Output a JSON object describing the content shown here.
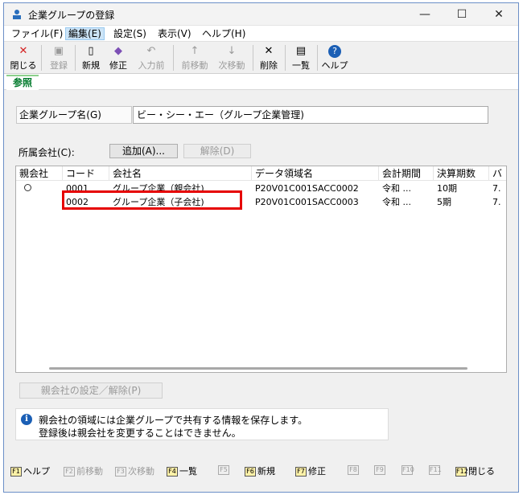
{
  "window": {
    "title": "企業グループの登録"
  },
  "titlebar_buttons": {
    "minimize": "—",
    "maximize": "☐",
    "close": "✕"
  },
  "menu": [
    {
      "label": "ファイル(F)"
    },
    {
      "label": "編集(E)"
    },
    {
      "label": "設定(S)"
    },
    {
      "label": "表示(V)"
    },
    {
      "label": "ヘルプ(H)"
    }
  ],
  "toolbar": {
    "close": {
      "label": "閉じる",
      "icon": "✕"
    },
    "register": {
      "label": "登録",
      "icon": "▣"
    },
    "new": {
      "label": "新規",
      "icon": "▯"
    },
    "modify": {
      "label": "修正",
      "icon": "◆"
    },
    "before_input": {
      "label": "入力前",
      "icon": "↶"
    },
    "prev": {
      "label": "前移動",
      "icon": "↑"
    },
    "next": {
      "label": "次移動",
      "icon": "↓"
    },
    "delete": {
      "label": "削除",
      "icon": "✕"
    },
    "list": {
      "label": "一覧",
      "icon": "▤"
    },
    "help": {
      "label": "ヘルプ",
      "icon": "?"
    }
  },
  "tab": {
    "label": "参照"
  },
  "form": {
    "group_name_label": "企業グループ名(G)",
    "group_name_value": "ビー・シー・エー（グループ企業管理)"
  },
  "affiliates": {
    "label": "所属会社(C):",
    "add_button": "追加(A)...",
    "remove_button": "解除(D)",
    "columns": [
      "親会社",
      "コード",
      "会社名",
      "データ領域名",
      "会計期間",
      "決算期数",
      "バ"
    ],
    "rows": [
      {
        "parent": true,
        "code": "0001",
        "name": "グループ企業（親会社)",
        "data_area": "P20V01C001SACC0002",
        "period": "令和 ...",
        "term": "10期",
        "extra": "7."
      },
      {
        "parent": false,
        "code": "0002",
        "name": "グループ企業（子会社)",
        "data_area": "P20V01C001SACC0003",
        "period": "令和 ...",
        "term": "5期",
        "extra": "7."
      }
    ]
  },
  "parent_button": "親会社の設定／解除(P)",
  "info": {
    "icon": "i",
    "line1": "親会社の領域には企業グループで共有する情報を保存します。",
    "line2": "登録後は親会社を変更することはできません。"
  },
  "fkeys": [
    {
      "key": "F1",
      "label": "ヘルプ",
      "enabled": true
    },
    {
      "key": "F2",
      "label": "前移動",
      "enabled": false
    },
    {
      "key": "F3",
      "label": "次移動",
      "enabled": false
    },
    {
      "key": "F4",
      "label": "一覧",
      "enabled": true
    },
    {
      "key": "F5",
      "label": "",
      "enabled": false
    },
    {
      "key": "F6",
      "label": "新規",
      "enabled": true
    },
    {
      "key": "F7",
      "label": "修正",
      "enabled": true
    },
    {
      "key": "F8",
      "label": "",
      "enabled": false
    },
    {
      "key": "F9",
      "label": "",
      "enabled": false
    },
    {
      "key": "F10",
      "label": "",
      "enabled": false
    },
    {
      "key": "F11",
      "label": "",
      "enabled": false
    },
    {
      "key": "F12",
      "label": "閉じる",
      "enabled": true
    }
  ],
  "colors": {
    "highlight": "#e60000",
    "tab_text": "#007a2b",
    "info_icon": "#1b5fb5"
  }
}
